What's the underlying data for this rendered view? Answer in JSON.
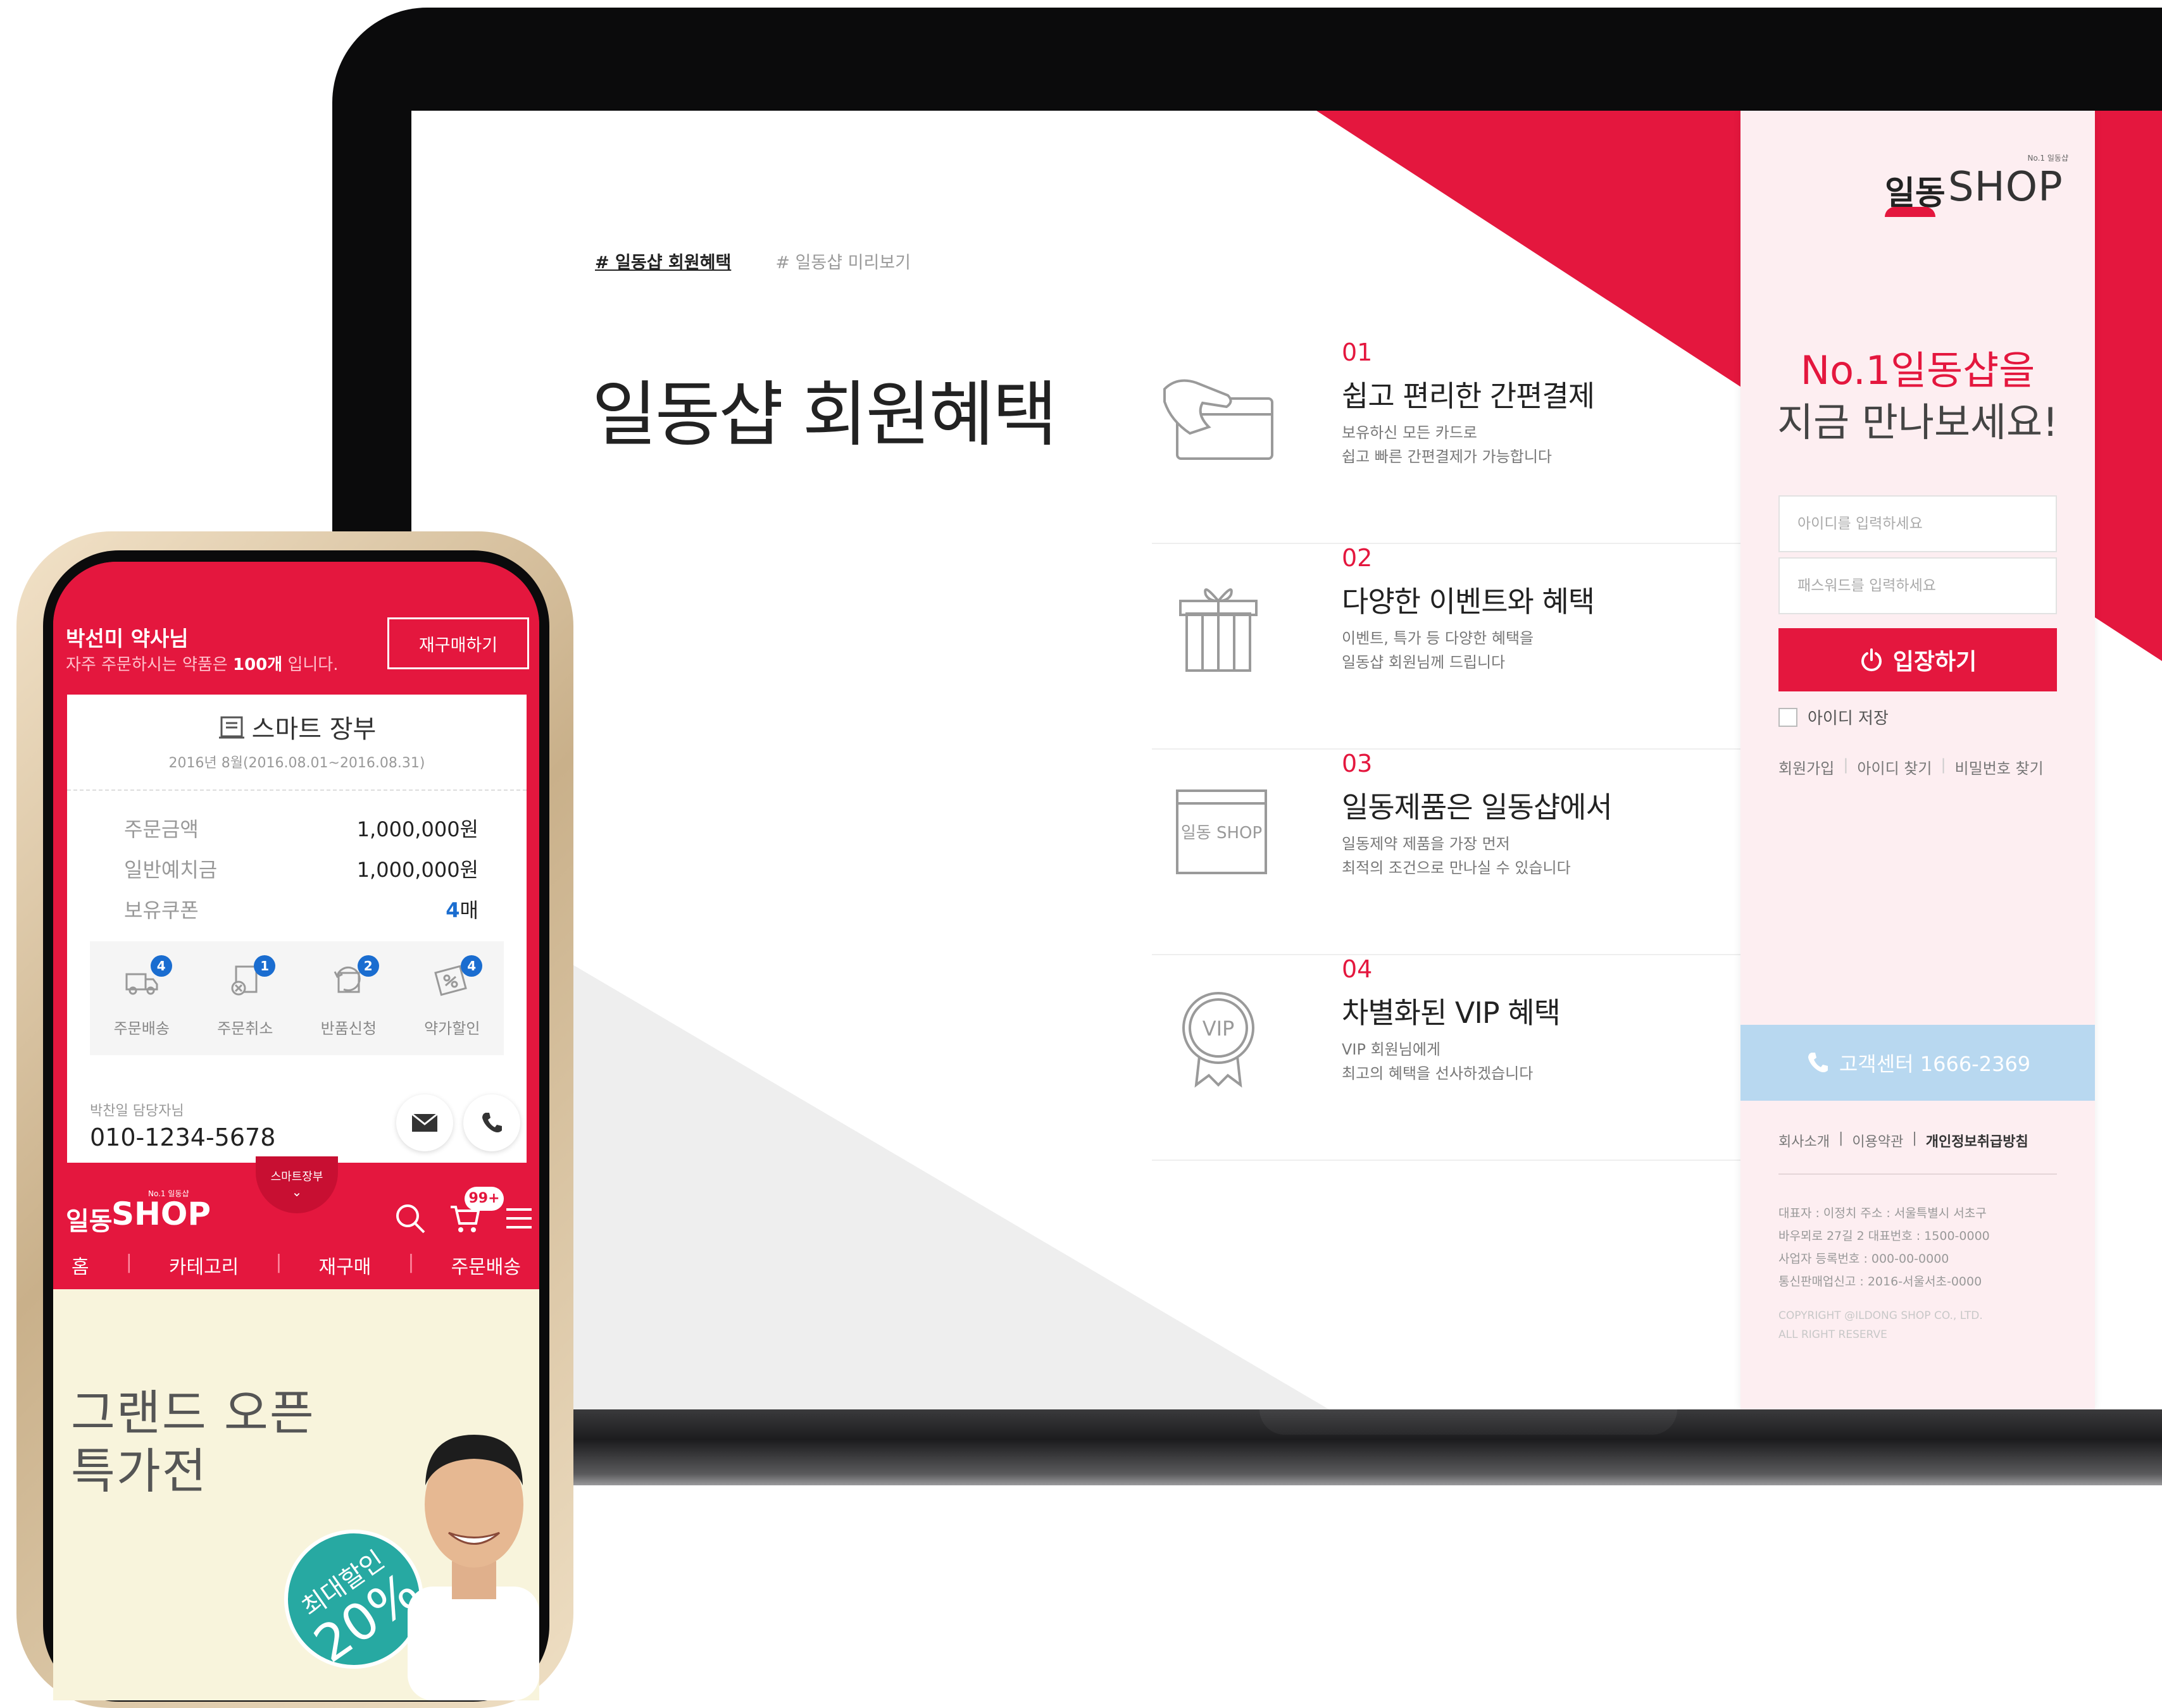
{
  "site": {
    "hashtags": [
      "# 일동샵 회원혜택",
      "# 일동샵 미리보기"
    ],
    "page_title": "일동샵 회원혜택",
    "benefits": [
      {
        "num": "01",
        "title": "쉽고 편리한 간편결제",
        "desc1": "보유하신 모든 카드로",
        "desc2": "쉽고 빠른 간편결제가 가능합니다",
        "icon": "card-payment-icon"
      },
      {
        "num": "02",
        "title": "다양한 이벤트와 혜택",
        "desc1": "이벤트, 특가 등 다양한 혜택을",
        "desc2": "일동샵 회원님께 드립니다",
        "icon": "gift-icon"
      },
      {
        "num": "03",
        "title": "일동제품은 일동샵에서",
        "desc1": "일동제약 제품을 가장 먼저",
        "desc2": "최적의 조건으로 만나실 수 있습니다",
        "icon": "shop-window-icon",
        "icon_text": "일동 SHOP"
      },
      {
        "num": "04",
        "title": "차별화된 VIP 혜택",
        "desc1": "VIP 회원님에게",
        "desc2": "최고의 혜택을 선사하겠습니다",
        "icon": "vip-badge-icon",
        "icon_text": "VIP"
      }
    ],
    "login": {
      "logo_small": "No.1 일동샵",
      "logo_kr": "일동",
      "logo_shop": "SHOP",
      "headline1": "No.1일동샵을",
      "headline2": "지금 만나보세요!",
      "id_placeholder": "아이디를 입력하세요",
      "pw_placeholder": "패스워드를 입력하세요",
      "login_button": "입장하기",
      "save_id": "아이디 저장",
      "links": [
        "회원가입",
        "아이디 찾기",
        "비밀번호 찾기"
      ],
      "customer_center": "고객센터 1666-2369",
      "footer_links": [
        "회사소개",
        "이용약관",
        "개인정보취급방침"
      ],
      "info": [
        "대표자 : 이정치   주소 : 서울특별시 서초구",
        "바우뫼로 27길 2   대표번호 : 1500-0000",
        "사업자 등록번호 : 000-00-0000",
        "통신판매업신고 : 2016-서울서초-0000"
      ],
      "copyright": [
        "COPYRIGHT @ILDONG SHOP CO., LTD.",
        "ALL RIGHT RESERVE"
      ]
    }
  },
  "phone": {
    "user_name": "박선미 약사님",
    "sub_pre": "자주 주문하시는 약품은 ",
    "sub_count": "100개",
    "sub_post": " 입니다.",
    "reorder_button": "재구매하기",
    "ledger_title": "스마트 장부",
    "ledger_period": "2016년 8월(2016.08.01~2016.08.31)",
    "rows": [
      {
        "label": "주문금액",
        "value": "1,000,000원"
      },
      {
        "label": "일반예치금",
        "value": "1,000,000원"
      },
      {
        "label": "보유쿠폰",
        "value_num": "4",
        "value_unit": "매"
      }
    ],
    "quick": [
      {
        "label": "주문배송",
        "badge": "4",
        "icon": "delivery-truck-icon"
      },
      {
        "label": "주문취소",
        "badge": "1",
        "icon": "order-cancel-icon"
      },
      {
        "label": "반품신청",
        "badge": "2",
        "icon": "return-icon"
      },
      {
        "label": "약가할인",
        "badge": "4",
        "icon": "discount-icon"
      }
    ],
    "manager_label": "박찬일 담당자님",
    "manager_phone": "010-1234-5678",
    "smart_tab": "스마트장부",
    "logo_small": "No.1 일동샵",
    "logo_kr": "일동",
    "logo_shop": "SHOP",
    "cart_badge": "99+",
    "menu": [
      "홈",
      "카테고리",
      "재구매",
      "주문배송"
    ],
    "banner_line1": "그랜드 오픈",
    "banner_line2": "특가전",
    "banner_badge1": "최대할인",
    "banner_badge2": "20%"
  },
  "colors": {
    "brand_red": "#e4173e",
    "accent_blue": "#1a6dd0",
    "teal": "#27a9a2",
    "sky": "#b8d8f0"
  }
}
